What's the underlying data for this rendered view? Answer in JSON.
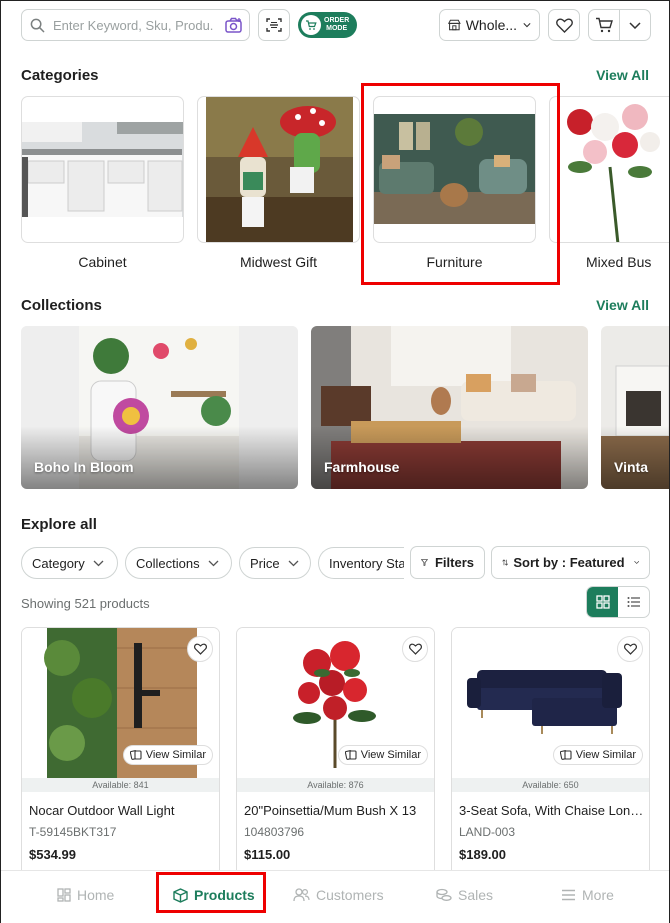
{
  "header": {
    "search_placeholder": "Enter Keyword, Sku, Produ...",
    "order_mode_line1": "ORDER",
    "order_mode_line2": "MODE",
    "price_tier": "Whole..."
  },
  "categories": {
    "title": "Categories",
    "view_all": "View All",
    "items": [
      {
        "label": "Cabinet"
      },
      {
        "label": "Midwest Gift"
      },
      {
        "label": "Furniture"
      },
      {
        "label": "Mixed Bus"
      }
    ]
  },
  "collections": {
    "title": "Collections",
    "view_all": "View All",
    "items": [
      {
        "label": "Boho In Bloom"
      },
      {
        "label": "Farmhouse"
      },
      {
        "label": "Vinta"
      }
    ]
  },
  "explore": {
    "title": "Explore all",
    "filters": {
      "category": "Category",
      "collections": "Collections",
      "price": "Price",
      "inventory": "Inventory Sta",
      "filters_button": "Filters",
      "sort": "Sort by : Featured"
    },
    "showing": "Showing 521 products"
  },
  "products": [
    {
      "available": "Available: 841",
      "name": "Nocar Outdoor Wall Light",
      "sku": "T-59145BKT317",
      "price": "$534.99",
      "view_similar": "View Similar"
    },
    {
      "available": "Available: 876",
      "name": "20\"Poinsettia/Mum Bush X 13",
      "sku": "104803796",
      "price": "$115.00",
      "view_similar": "View Similar"
    },
    {
      "available": "Available: 650",
      "name": "3-Seat Sofa, With Chaise Long...",
      "sku": "LAND-003",
      "price": "$189.00",
      "view_similar": "View Similar"
    }
  ],
  "bottom_nav": {
    "home": "Home",
    "products": "Products",
    "customers": "Customers",
    "sales": "Sales",
    "more": "More"
  },
  "colors": {
    "accent": "#1d7d5c",
    "highlight": "#e00000"
  }
}
